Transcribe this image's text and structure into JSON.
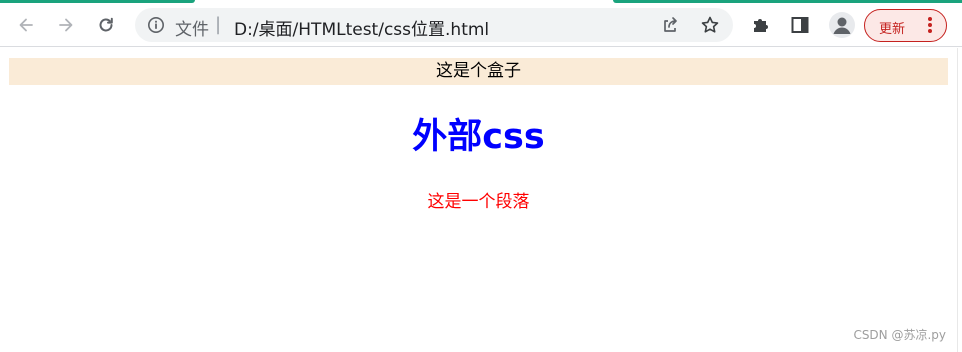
{
  "browser": {
    "scheme_label": "文件",
    "scheme_separator": "|",
    "url": "D:/桌面/HTMLtest/css位置.html",
    "update_label": "更新",
    "icons": {
      "back": "arrow-left-icon",
      "forward": "arrow-right-icon",
      "reload": "reload-icon",
      "info": "info-icon",
      "share": "share-icon",
      "bookmark": "star-icon",
      "extensions": "puzzle-icon",
      "side_panel": "side-panel-icon",
      "profile": "person-icon",
      "menu": "kebab-menu-icon"
    },
    "colors": {
      "accent_tab": "#1aa37d",
      "update_red": "#c5221f"
    }
  },
  "page": {
    "box_text": "这是个盒子",
    "heading": "外部css",
    "paragraph": "这是一个段落",
    "colors": {
      "box_background": "#faebd7",
      "heading": "#0000ff",
      "paragraph": "#ff0000"
    }
  },
  "watermark": "CSDN @苏凉.py"
}
